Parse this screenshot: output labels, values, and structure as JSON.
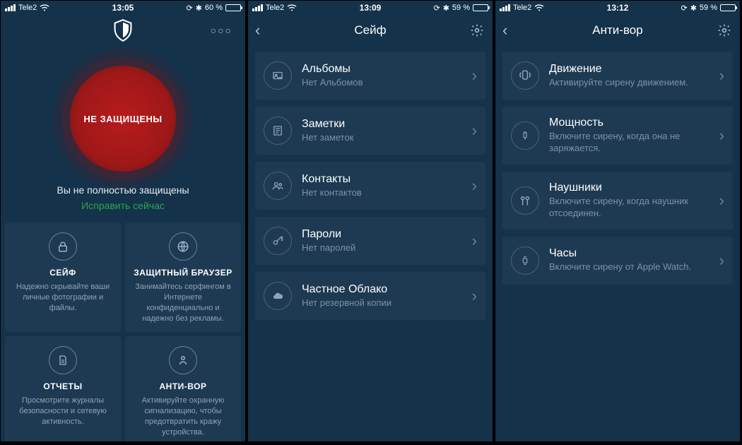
{
  "screens": [
    {
      "status": {
        "carrier": "Tele2",
        "time": "13:05",
        "battery_pct": "60 %"
      },
      "hero": {
        "badge": "НЕ ЗАЩИЩЕНЫ",
        "status_text": "Вы не полностью защищены",
        "fix_link": "Исправить сейчас"
      },
      "cards": [
        {
          "icon": "lock-icon",
          "title": "СЕЙФ",
          "desc": "Надежно скрывайте ваши личные фотографии и файлы."
        },
        {
          "icon": "globe-icon",
          "title": "ЗАЩИТНЫЙ БРАУЗЕР",
          "desc": "Занимайтесь серфингом в Интернете конфиденциально и надежно без рекламы."
        },
        {
          "icon": "document-icon",
          "title": "ОТЧЕТЫ",
          "desc": "Просмотрите журналы безопасности и сетевую активность."
        },
        {
          "icon": "person-shield-icon",
          "title": "АНТИ-ВОР",
          "desc": "Активируйте охранную сигнализацию, чтобы предотвратить кражу устройства."
        }
      ]
    },
    {
      "status": {
        "carrier": "Tele2",
        "time": "13:09",
        "battery_pct": "59 %"
      },
      "title": "Сейф",
      "rows": [
        {
          "icon": "photo-icon",
          "title": "Альбомы",
          "sub": "Нет Альбомов"
        },
        {
          "icon": "note-icon",
          "title": "Заметки",
          "sub": "Нет заметок"
        },
        {
          "icon": "contacts-icon",
          "title": "Контакты",
          "sub": "Нет контактов"
        },
        {
          "icon": "key-icon",
          "title": "Пароли",
          "sub": "Нет паролей"
        },
        {
          "icon": "cloud-icon",
          "title": "Частное Облако",
          "sub": "Нет резервной копии"
        }
      ]
    },
    {
      "status": {
        "carrier": "Tele2",
        "time": "13:12",
        "battery_pct": "59 %"
      },
      "title": "Анти-вор",
      "rows": [
        {
          "icon": "motion-icon",
          "title": "Движение",
          "sub": "Активируйте сирену движением."
        },
        {
          "icon": "plug-icon",
          "title": "Мощность",
          "sub": "Включите сирену, когда она не заряжается."
        },
        {
          "icon": "headphones-icon",
          "title": "Наушники",
          "sub": "Включите сирену, когда наушник отсоединен."
        },
        {
          "icon": "watch-icon",
          "title": "Часы",
          "sub": "Включите сирену от Apple Watch."
        }
      ]
    }
  ]
}
